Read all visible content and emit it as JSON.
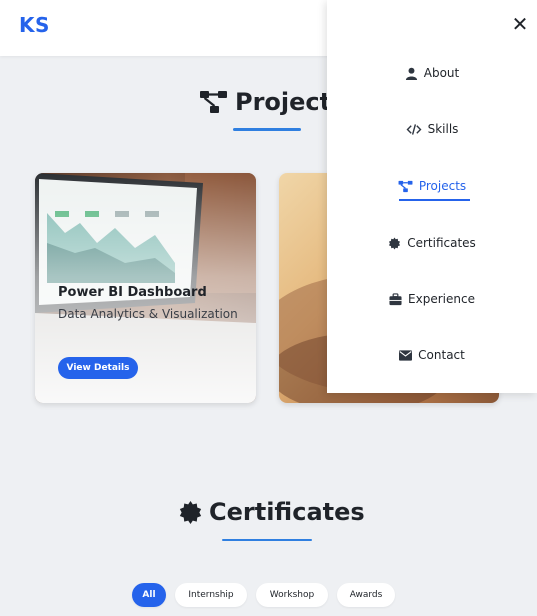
{
  "header": {
    "logo": "KS"
  },
  "projects": {
    "title": "Projects",
    "cards": [
      {
        "title": "Power BI Dashboard",
        "description": "Data Analytics & Visualization",
        "button": "View Details"
      }
    ]
  },
  "certificates": {
    "title": "Certificates",
    "filters": [
      "All",
      "Internship",
      "Workshop",
      "Awards"
    ],
    "active_filter": "All"
  },
  "menu": {
    "items": [
      {
        "label": "About",
        "icon": "user-icon"
      },
      {
        "label": "Skills",
        "icon": "code-icon"
      },
      {
        "label": "Projects",
        "icon": "project-diagram-icon"
      },
      {
        "label": "Certificates",
        "icon": "certificate-icon"
      },
      {
        "label": "Experience",
        "icon": "briefcase-icon"
      },
      {
        "label": "Contact",
        "icon": "envelope-icon"
      }
    ],
    "active": "Projects"
  },
  "colors": {
    "accent": "#2563eb",
    "background": "#eef0f3"
  }
}
